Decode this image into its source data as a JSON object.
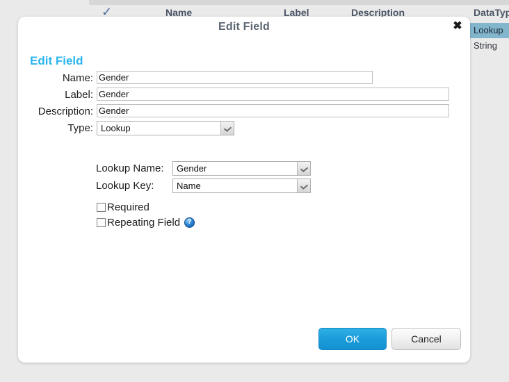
{
  "background": {
    "table_header": {
      "select_all_icon": "checkmark-icon",
      "columns": [
        "Name",
        "Label",
        "Description",
        "DataTyp"
      ]
    },
    "datatype_rows": [
      {
        "value": "Lookup",
        "selected": true
      },
      {
        "value": "String",
        "selected": false
      }
    ]
  },
  "dialog": {
    "title": "Edit Field",
    "close_icon": "close-icon",
    "heading": "Edit Field",
    "fields": {
      "name": {
        "label": "Name:",
        "value": "Gender"
      },
      "label": {
        "label": "Label:",
        "value": "Gender"
      },
      "description": {
        "label": "Description:",
        "value": "Gender"
      },
      "type": {
        "label": "Type:",
        "value": "Lookup",
        "dropdown_icon": "chevron-down-icon"
      },
      "lookup_name": {
        "label": "Lookup Name:",
        "value": "Gender",
        "dropdown_icon": "chevron-down-icon"
      },
      "lookup_key": {
        "label": "Lookup Key:",
        "value": "Name",
        "dropdown_icon": "chevron-down-icon"
      }
    },
    "checkboxes": [
      {
        "label": "Required",
        "checked": false
      },
      {
        "label": "Repeating Field",
        "checked": false,
        "help_icon": "help-icon"
      }
    ],
    "buttons": {
      "ok": "OK",
      "cancel": "Cancel"
    }
  },
  "colors": {
    "heading": "#2ab6ed",
    "primary_button": "#1b9cd9",
    "selected_row": "#82b6cd"
  }
}
